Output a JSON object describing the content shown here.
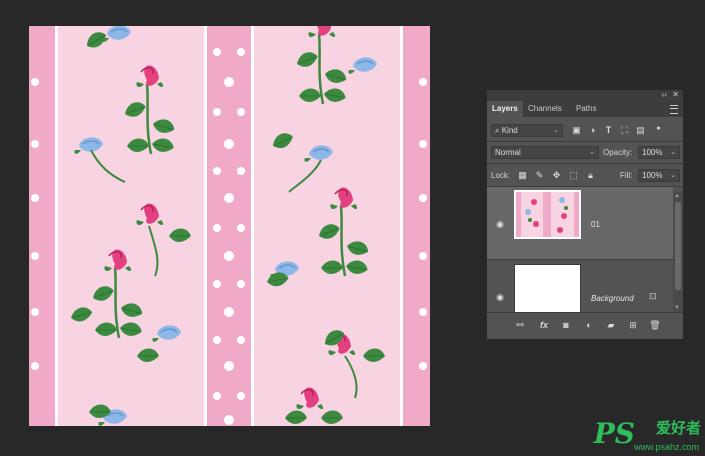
{
  "panel": {
    "tabs": [
      "Layers",
      "Channels",
      "Paths"
    ],
    "active_tab": "Layers",
    "filter": {
      "kind_label": "Kind"
    },
    "blend": {
      "mode": "Normal",
      "opacity_label": "Opacity:",
      "opacity_value": "100%"
    },
    "lock": {
      "label": "Lock:",
      "fill_label": "Fill:",
      "fill_value": "100%"
    },
    "layers": [
      {
        "name": "01",
        "visible": true,
        "italic": false
      },
      {
        "name": "Background",
        "visible": true,
        "italic": true,
        "locked": true
      }
    ]
  },
  "watermark": {
    "logo": "PS",
    "chinese": "爱好者",
    "url": "www.psahz.com"
  },
  "colors": {
    "canvas_background": "#282828",
    "pattern_pink_dark": "#f0a9c7",
    "pattern_pink_light": "#f8d3e2",
    "rose_pink": "#e2407f",
    "flower_blue": "#8db7e6",
    "leaf_green": "#3c8a3f",
    "panel_bg": "#535353",
    "watermark_green": "#2ebd5b"
  }
}
